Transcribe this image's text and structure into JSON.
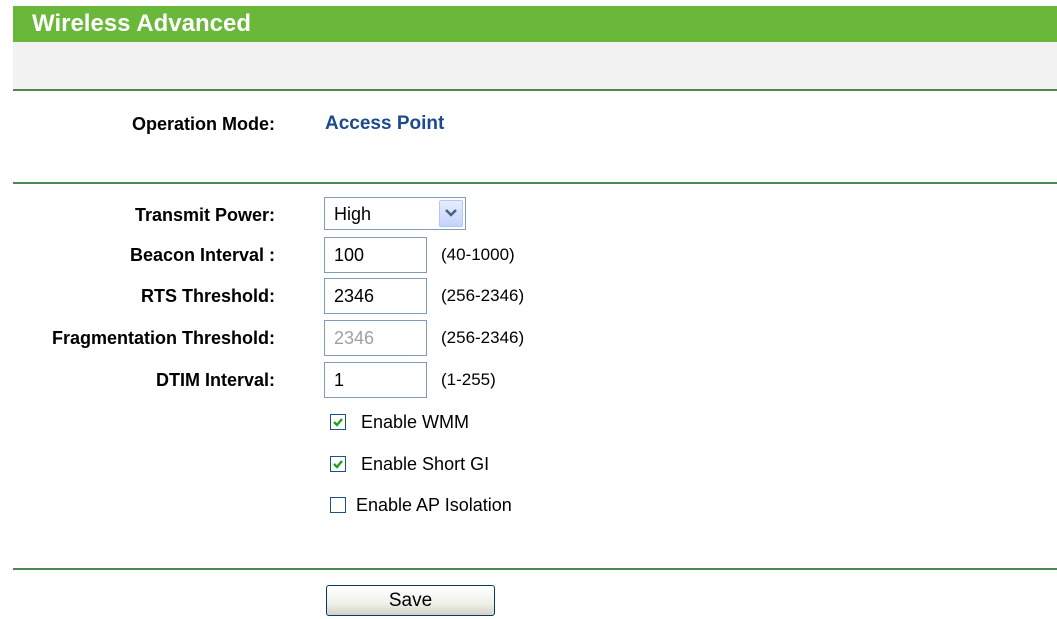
{
  "header": {
    "title": "Wireless Advanced"
  },
  "operation_mode": {
    "label": "Operation Mode:",
    "value": "Access Point"
  },
  "transmit_power": {
    "label": "Transmit Power:",
    "selected": "High"
  },
  "beacon_interval": {
    "label": "Beacon Interval :",
    "value": "100",
    "range": "(40-1000)"
  },
  "rts_threshold": {
    "label": "RTS Threshold:",
    "value": "2346",
    "range": "(256-2346)"
  },
  "fragmentation_threshold": {
    "label": "Fragmentation Threshold:",
    "value": "2346",
    "range": "(256-2346)",
    "disabled": true
  },
  "dtim_interval": {
    "label": "DTIM Interval:",
    "value": "1",
    "range": "(1-255)"
  },
  "options": [
    {
      "label": "Enable WMM",
      "checked": true
    },
    {
      "label": "Enable Short GI",
      "checked": true
    },
    {
      "label": "Enable AP Isolation",
      "checked": false
    }
  ],
  "actions": {
    "save_label": "Save"
  },
  "colors": {
    "header_bg": "#6ab83a",
    "divider": "#4a8a50",
    "band_bg": "#f2f2f2",
    "mode_text": "#1c4a8c"
  }
}
